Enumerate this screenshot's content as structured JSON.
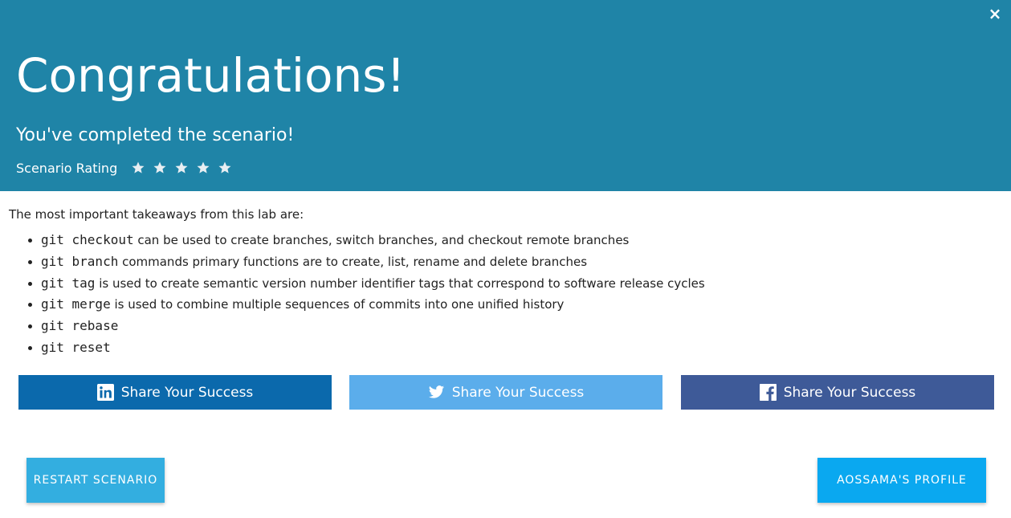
{
  "header": {
    "close_label": "×",
    "title": "Congratulations!",
    "subtitle": "You've completed the scenario!",
    "rating_label": "Scenario Rating",
    "rating_stars": 5
  },
  "content": {
    "intro": "The most important takeaways from this lab are:",
    "takeaways": [
      {
        "code": "git checkout",
        "text": " can be used to create branches, switch branches, and checkout remote branches"
      },
      {
        "code": "git branch",
        "text": " commands primary functions are to create, list, rename and delete branches"
      },
      {
        "code": "git tag",
        "text": " is used to create semantic version number identifier tags that correspond to software release cycles"
      },
      {
        "code": "git merge",
        "text": " is used to combine multiple sequences of commits into one unified history"
      },
      {
        "code": "git rebase",
        "text": ""
      },
      {
        "code": "git reset",
        "text": ""
      }
    ]
  },
  "share": {
    "linkedin_label": "Share Your Success",
    "twitter_label": "Share Your Success",
    "facebook_label": "Share Your Success",
    "icons": [
      "linkedin-icon",
      "twitter-icon",
      "facebook-icon"
    ]
  },
  "actions": {
    "restart_label": "Restart Scenario",
    "profile_label": "aossama's profile"
  },
  "colors": {
    "header_bg": "#1f84a7",
    "linkedin": "#0b69ac",
    "twitter": "#5badeb",
    "facebook": "#3e5a98",
    "restart": "#33aee0",
    "profile": "#0aa8f0"
  }
}
